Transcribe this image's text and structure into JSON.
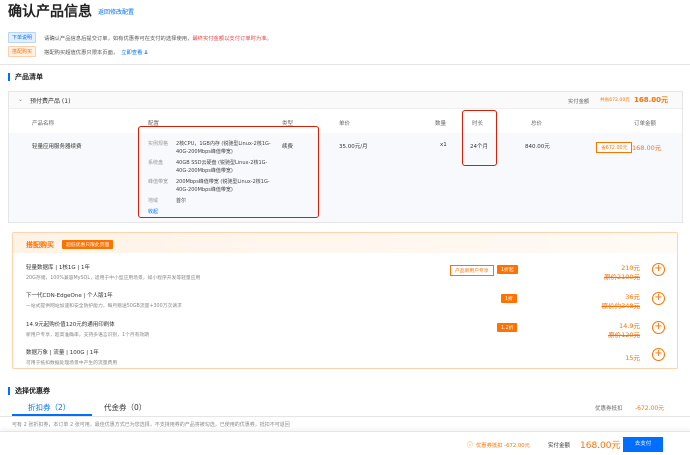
{
  "page": {
    "title": "确认产品信息",
    "back_link": "返回修改配置"
  },
  "notices": [
    {
      "tag": "下单说明",
      "text": "请确认产品信息后提交订单，如有优惠券可在支付的选择使用，",
      "highlight": "最终实付金额以支付订单时为准。"
    },
    {
      "tag": "搭配购买",
      "text": "搭配购买超值优惠只限本页面，",
      "link": "立即查看 ⇊"
    }
  ],
  "product_list": {
    "section_title": "产品清单",
    "group_label": "预付费产品 (1)",
    "group_total_label": "实付金额",
    "group_discount": "共省672.00元",
    "group_total": "168.00元",
    "columns": [
      "产品名称",
      "配置",
      "类型",
      "单价",
      "数量",
      "时长",
      "总价",
      "订单金额"
    ],
    "row": {
      "name": "轻量应用服务器续费",
      "type": "续费",
      "unit_price": "35.00元/月",
      "quantity": "x1",
      "duration": "24个月",
      "total": "840.00元",
      "discount_tag": "省672.00元",
      "order_amount": "168.00元",
      "config": [
        {
          "label": "实例规格",
          "value": "2核CPU，1GB内存 (锐驰型Linux-2核1G-40G-200Mbps峰值带宽)"
        },
        {
          "label": "系统盘",
          "value": "40GB SSD云硬盘 (锐驰型Linux-2核1G-40G-200Mbps峰值带宽)"
        },
        {
          "label": "峰值带宽",
          "value": "200Mbps峰值带宽 (锐驰型Linux-2核1G-40G-200Mbps峰值带宽)"
        },
        {
          "label": "地域",
          "value": "首尔"
        }
      ],
      "collapse": "收起"
    }
  },
  "addon": {
    "title": "搭配购买",
    "tag": "超低优惠只限此页面",
    "items": [
      {
        "title": "轻量数据库 | 1核1G | 1年",
        "desc": "20G存储，100%兼容MySQL，适用于中小型应用场景，如小程序开发等轻量应用",
        "tag_outline": "产品新用户专享",
        "tag": "1折起",
        "price": "210元",
        "original": "原价2100元"
      },
      {
        "title": "下一代CDN-EdgeOne | 个人版1年",
        "desc": "一站式提供网站加速和安全防护能力，每月赠送50GB流量+300万次请求",
        "tag_outline": "",
        "tag": "1折",
        "price": "36元",
        "original": "原价约348元"
      },
      {
        "title": "14.9元起购价值120元的通用印刷体",
        "desc": "新用户专享，超高准确率，支持多语言识别，1个月有效期",
        "tag_outline": "",
        "tag": "1.2折",
        "price": "14.9元",
        "original": "原价120元"
      },
      {
        "title": "数据万象 | 流量 | 100G | 1年",
        "desc": "可用于抵扣数据处理场景中产生的流量费用",
        "tag_outline": "",
        "tag": "",
        "price": "15元",
        "original": ""
      }
    ]
  },
  "coupons": {
    "section_title": "选择优惠券",
    "tabs": [
      {
        "label": "折扣券（2）",
        "active": true
      },
      {
        "label": "代金券（0）",
        "active": false
      }
    ],
    "discount_label": "优惠券抵扣",
    "discount_value": "-672.00元",
    "footnote": "可有 2 张折扣券，本订单 2 张可用，最佳优惠方式已为您选择，不支持用券的产品将被勾选，已使用的优惠券，抵扣不可退回"
  },
  "footer": {
    "discount_text": "优惠券抵扣 -672.00元",
    "total_label": "实付金额",
    "total_value": "168.00元",
    "pay_button": "去支付"
  },
  "colors": {
    "accent": "#006eff",
    "orange": "#ff7200",
    "highlight_box": "#d81e06"
  }
}
